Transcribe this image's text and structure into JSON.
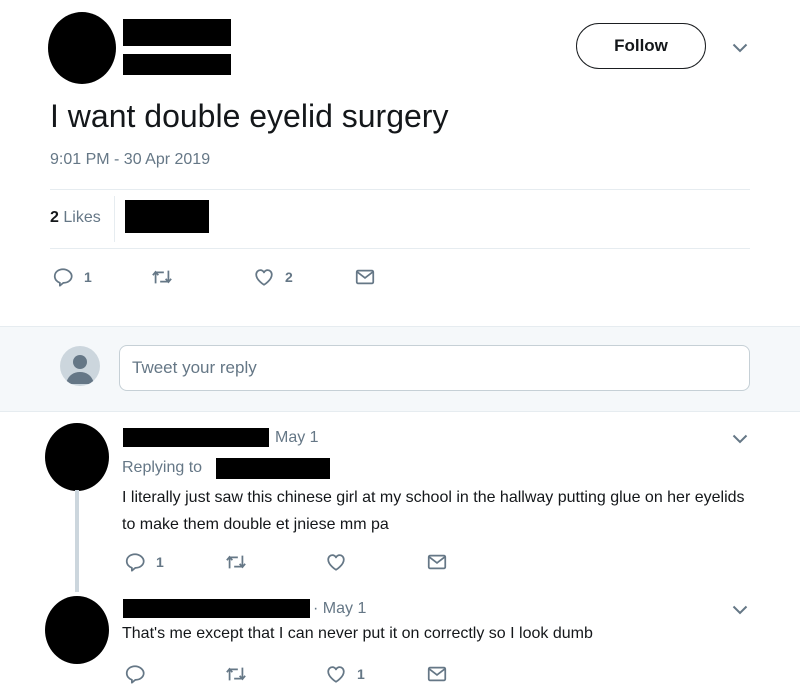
{
  "tweet": {
    "follow_label": "Follow",
    "text": "I want double eyelid surgery",
    "timestamp": "9:01 PM - 30 Apr 2019",
    "likes_count": "2",
    "likes_label": "Likes",
    "reply_count": "1",
    "like_count": "2"
  },
  "reply_box": {
    "placeholder": "Tweet your reply"
  },
  "replies": [
    {
      "date": "May 1",
      "replying_to_label": "Replying to",
      "text": "I literally just saw this chinese girl at my school in the hallway putting glue on her eyelids to make them double et jniese mm pa",
      "reply_count": "1",
      "like_count": ""
    },
    {
      "date": "· May 1",
      "text": "That's me except that I can never put it on correctly so I look dumb",
      "reply_count": "",
      "like_count": "1"
    }
  ],
  "icons": [
    "reply-icon",
    "retweet-icon",
    "heart-icon",
    "mail-icon",
    "chevron-down-icon",
    "default-avatar-icon"
  ],
  "colors": {
    "text": "#14171a",
    "muted": "#657786",
    "band": "#f5f8fa",
    "divider": "#e6ecf0"
  }
}
